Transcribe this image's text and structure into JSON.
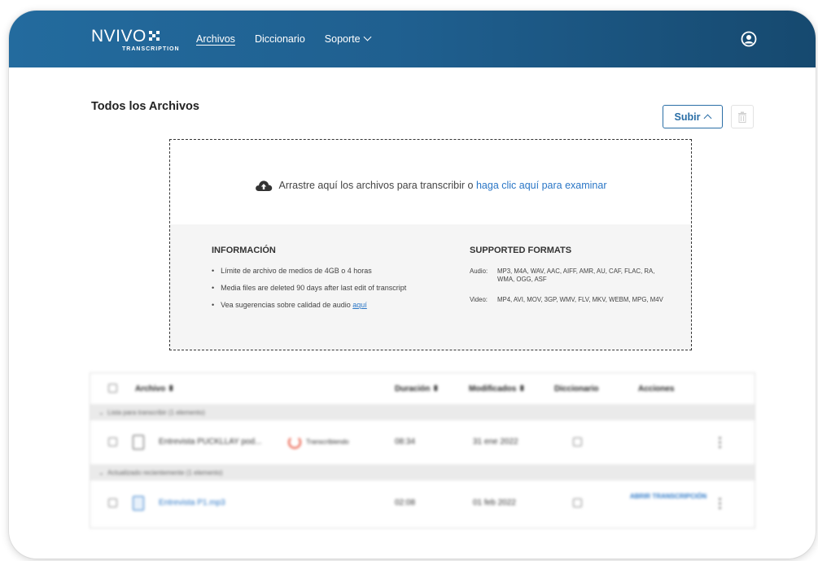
{
  "app": {
    "logo_text": "NVIVO",
    "logo_subtitle": "TRANSCRIPTION"
  },
  "nav": {
    "items": [
      "Archivos",
      "Diccionario",
      "Soporte"
    ],
    "active": "Archivos"
  },
  "page": {
    "title": "Todos los Archivos",
    "upload_button": "Subir"
  },
  "dropzone": {
    "prompt": "Arrastre aquí los archivos para transcribir o ",
    "prompt_link": "haga clic aquí para examinar",
    "info_heading": "INFORMACIÓN",
    "info_items": [
      "Límite de archivo de medios de 4GB o 4 horas",
      "Media files are deleted 90 days after last edit of transcript",
      "Vea sugerencias sobre calidad de audio "
    ],
    "info_link": "aquí",
    "formats_heading": "SUPPORTED FORMATS",
    "audio_label": "Audio:",
    "audio_formats": "MP3, M4A, WAV, AAC, AIFF, AMR, AU, CAF, FLAC, RA, WMA, OGG, ASF",
    "video_label": "Video:",
    "video_formats": "MP4, AVI, MOV, 3GP, WMV, FLV, MKV, WEBM, MPG, M4V"
  },
  "table": {
    "columns": [
      "Archivo",
      "Duración",
      "Modificados",
      "Diccionario",
      "Acciones"
    ],
    "groups": [
      {
        "label": "Lista para transcribir (1 elemento)",
        "rows": [
          {
            "name": "Entrevista PUCKLLAY pod...",
            "status": "Transcribiendo",
            "duration": "08:34",
            "modified": "31 ene 2022",
            "action": ""
          }
        ]
      },
      {
        "label": "Actualizado recientemente (1 elemento)",
        "rows": [
          {
            "name": "Entrevista P1.mp3",
            "status": "",
            "duration": "02:08",
            "modified": "01 feb 2022",
            "action": "ABRIR TRANSCRIPCIÓN"
          }
        ]
      }
    ]
  },
  "colors": {
    "header_start": "#236b9e",
    "header_end": "#16496f",
    "accent": "#2a6ea6",
    "link": "#2a76c6"
  }
}
